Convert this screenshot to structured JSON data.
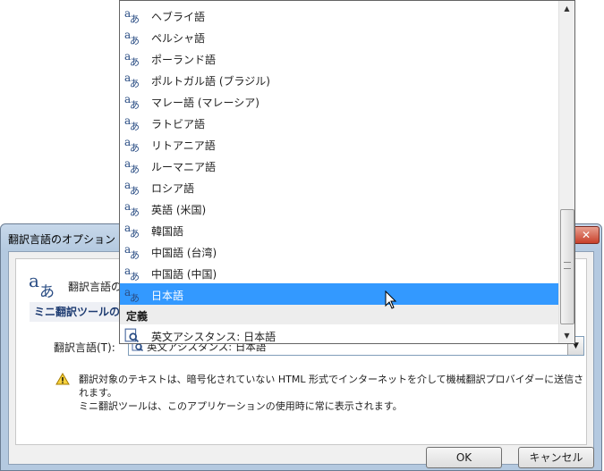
{
  "dialog": {
    "title": "翻訳言語のオプション",
    "close_glyph": "✕",
    "header_text": "翻訳言語の",
    "section_label": "ミニ翻訳ツールの言",
    "lang_label": "翻訳言語(T):",
    "combo_value": "英文アシスタンス: 日本語",
    "warning_line1": "翻訳対象のテキストは、暗号化されていない HTML 形式でインターネットを介して機械翻訳プロバイダーに送信されます。",
    "warning_line2": "ミニ翻訳ツールは、このアプリケーションの使用時に常に表示されます。",
    "ok_label": "OK",
    "cancel_label": "キャンセル"
  },
  "dropdown": {
    "items": [
      {
        "label": "ヘブライ語"
      },
      {
        "label": "ペルシャ語"
      },
      {
        "label": "ポーランド語"
      },
      {
        "label": "ポルトガル語 (ブラジル)"
      },
      {
        "label": "マレー語 (マレーシア)"
      },
      {
        "label": "ラトビア語"
      },
      {
        "label": "リトアニア語"
      },
      {
        "label": "ルーマニア語"
      },
      {
        "label": "ロシア語"
      },
      {
        "label": "英語 (米国)"
      },
      {
        "label": "韓国語"
      },
      {
        "label": "中国語 (台湾)"
      },
      {
        "label": "中国語 (中国)"
      },
      {
        "label": "日本語",
        "selected": true
      }
    ],
    "group_label": "定義",
    "dict_item": "英文アシスタンス: 日本語"
  },
  "icons": {
    "translate": "translate-icon",
    "dictionary": "dictionary-icon",
    "warning": "warning-icon"
  },
  "colors": {
    "selection": "#3399ff",
    "accent": "#2a4d84"
  }
}
